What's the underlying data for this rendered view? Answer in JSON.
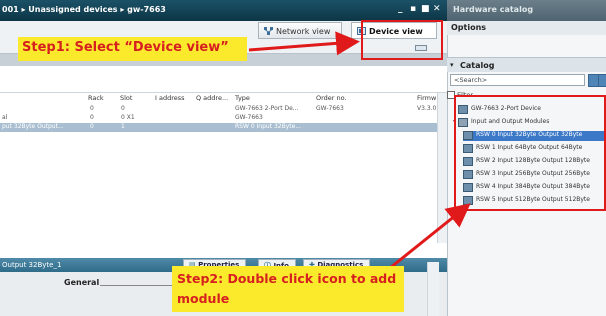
{
  "window": {
    "title": "001 ▸ Unassigned devices ▸ gw-7663",
    "win_buttons": [
      "_",
      "▪",
      "■",
      "✕"
    ]
  },
  "hardware_catalog": {
    "title": "Hardware catalog",
    "options_label": "Options",
    "catalog_label": "Catalog",
    "search_placeholder": "<Search>",
    "filter_label": "Filter",
    "items": [
      {
        "label": "GW-7663 2-Port Device",
        "level": 1
      },
      {
        "label": "Input and Output Modules",
        "level": 1
      },
      {
        "label": "RSW 0 Input 32Byte Output 32Byte",
        "level": 2,
        "selected": true
      },
      {
        "label": "RSW 1 Input 64Byte Output 64Byte",
        "level": 2
      },
      {
        "label": "RSW 2 Input 128Byte Output 128Byte",
        "level": 2
      },
      {
        "label": "RSW 3 Input 256Byte Output 256Byte",
        "level": 2
      },
      {
        "label": "RSW 4 Input 384Byte Output 384Byte",
        "level": 2
      },
      {
        "label": "RSW 5 Input 512Byte Output 512Byte",
        "level": 2
      }
    ]
  },
  "views": {
    "network_view": "Network view",
    "device_view": "Device view"
  },
  "table": {
    "columns": [
      "Rack",
      "Slot",
      "I address",
      "Q addre...",
      "Type",
      "Order no.",
      "Firmw"
    ],
    "rows": [
      {
        "name": "",
        "rack": "0",
        "slot": "0",
        "iaddr": "",
        "qaddr": "",
        "type": "GW-7663 2-Port De...",
        "order": "GW-7663",
        "fw": "V3.3.0"
      },
      {
        "name": "al",
        "rack": "0",
        "slot": "0 X1",
        "iaddr": "",
        "qaddr": "",
        "type": "GW-7663",
        "order": "",
        "fw": ""
      },
      {
        "name": "put 32Byte Output...",
        "rack": "0",
        "slot": "1",
        "iaddr": "",
        "qaddr": "",
        "type": "RSW 0 Input 32Byte...",
        "order": "",
        "fw": "",
        "selected": true
      }
    ]
  },
  "lower_pane": {
    "title": "Output 32Byte_1",
    "tabs": [
      "Properties",
      "Info",
      "Diagnostics"
    ],
    "section": "General"
  },
  "annotations": {
    "step1": "Step1: Select “Device view”",
    "step2": "Step2: Double click icon to add module"
  },
  "colors": {
    "callout_bg": "#fbea2b",
    "callout_text": "#d62020",
    "highlight_border": "#e01a1a",
    "selection": "#3b78c7"
  }
}
